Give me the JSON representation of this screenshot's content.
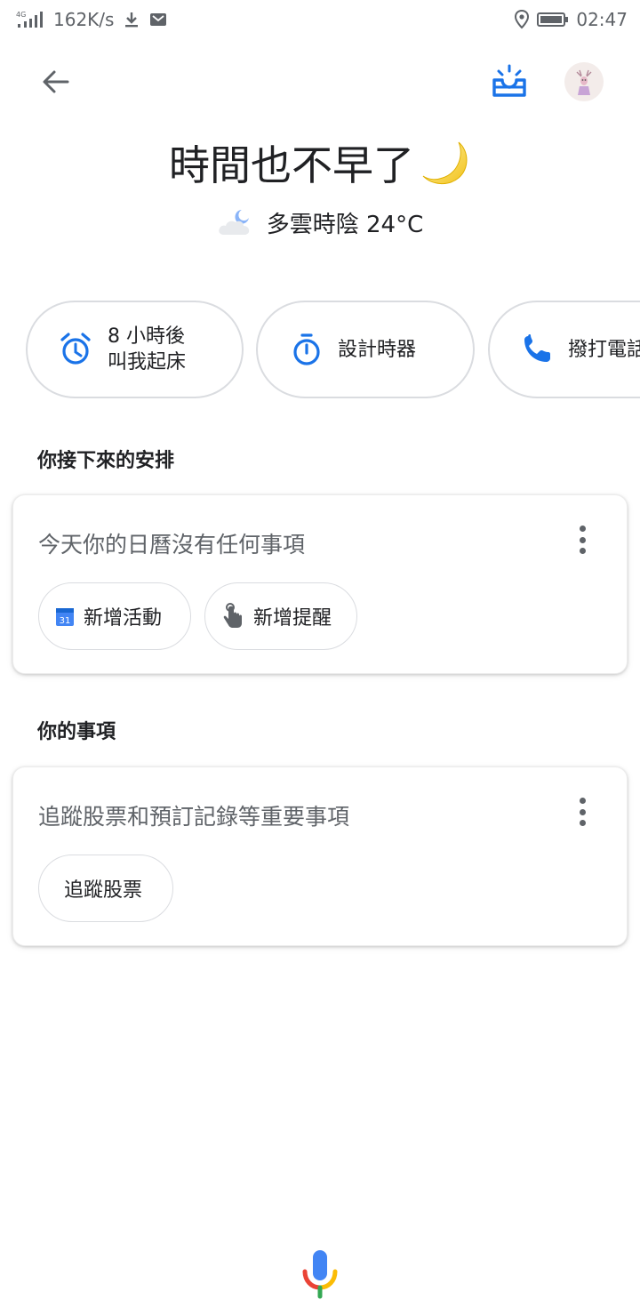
{
  "status_bar": {
    "network": "4G",
    "speed": "162K/s",
    "time": "02:47",
    "icons": [
      "signal-icon",
      "download-icon",
      "mail-icon",
      "location-icon",
      "battery-icon"
    ]
  },
  "top_bar": {
    "back_icon": "arrow-back-icon",
    "sunrise_icon": "sunrise-icon",
    "avatar_icon": "deer-avatar"
  },
  "greeting": {
    "text": "時間也不早了",
    "emoji": "🌙"
  },
  "weather": {
    "icon": "cloudy-night-icon",
    "text": "多雲時陰 24°C"
  },
  "quick_actions": [
    {
      "icon": "alarm-icon",
      "label": "8 小時後\n叫我起床"
    },
    {
      "icon": "timer-icon",
      "label": "設計時器"
    },
    {
      "icon": "phone-icon",
      "label": "撥打電話"
    }
  ],
  "upcoming": {
    "section_title": "你接下來的安排",
    "message": "今天你的日曆沒有任何事項",
    "actions": [
      {
        "icon": "calendar-icon",
        "label": "新增活動",
        "calendar_day": "31"
      },
      {
        "icon": "reminder-hand-icon",
        "label": "新增提醒"
      }
    ]
  },
  "your_items": {
    "section_title": "你的事項",
    "message": "追蹤股票和預訂記錄等重要事項",
    "actions": [
      {
        "label": "追蹤股票"
      }
    ]
  },
  "colors": {
    "accent_blue": "#1a73e8",
    "text_primary": "#202124",
    "text_secondary": "#5f6368",
    "chip_border": "#dadce0",
    "mic_blue": "#4285f4",
    "mic_red": "#ea4335",
    "mic_yellow": "#fbbc05",
    "mic_green": "#34a853"
  }
}
